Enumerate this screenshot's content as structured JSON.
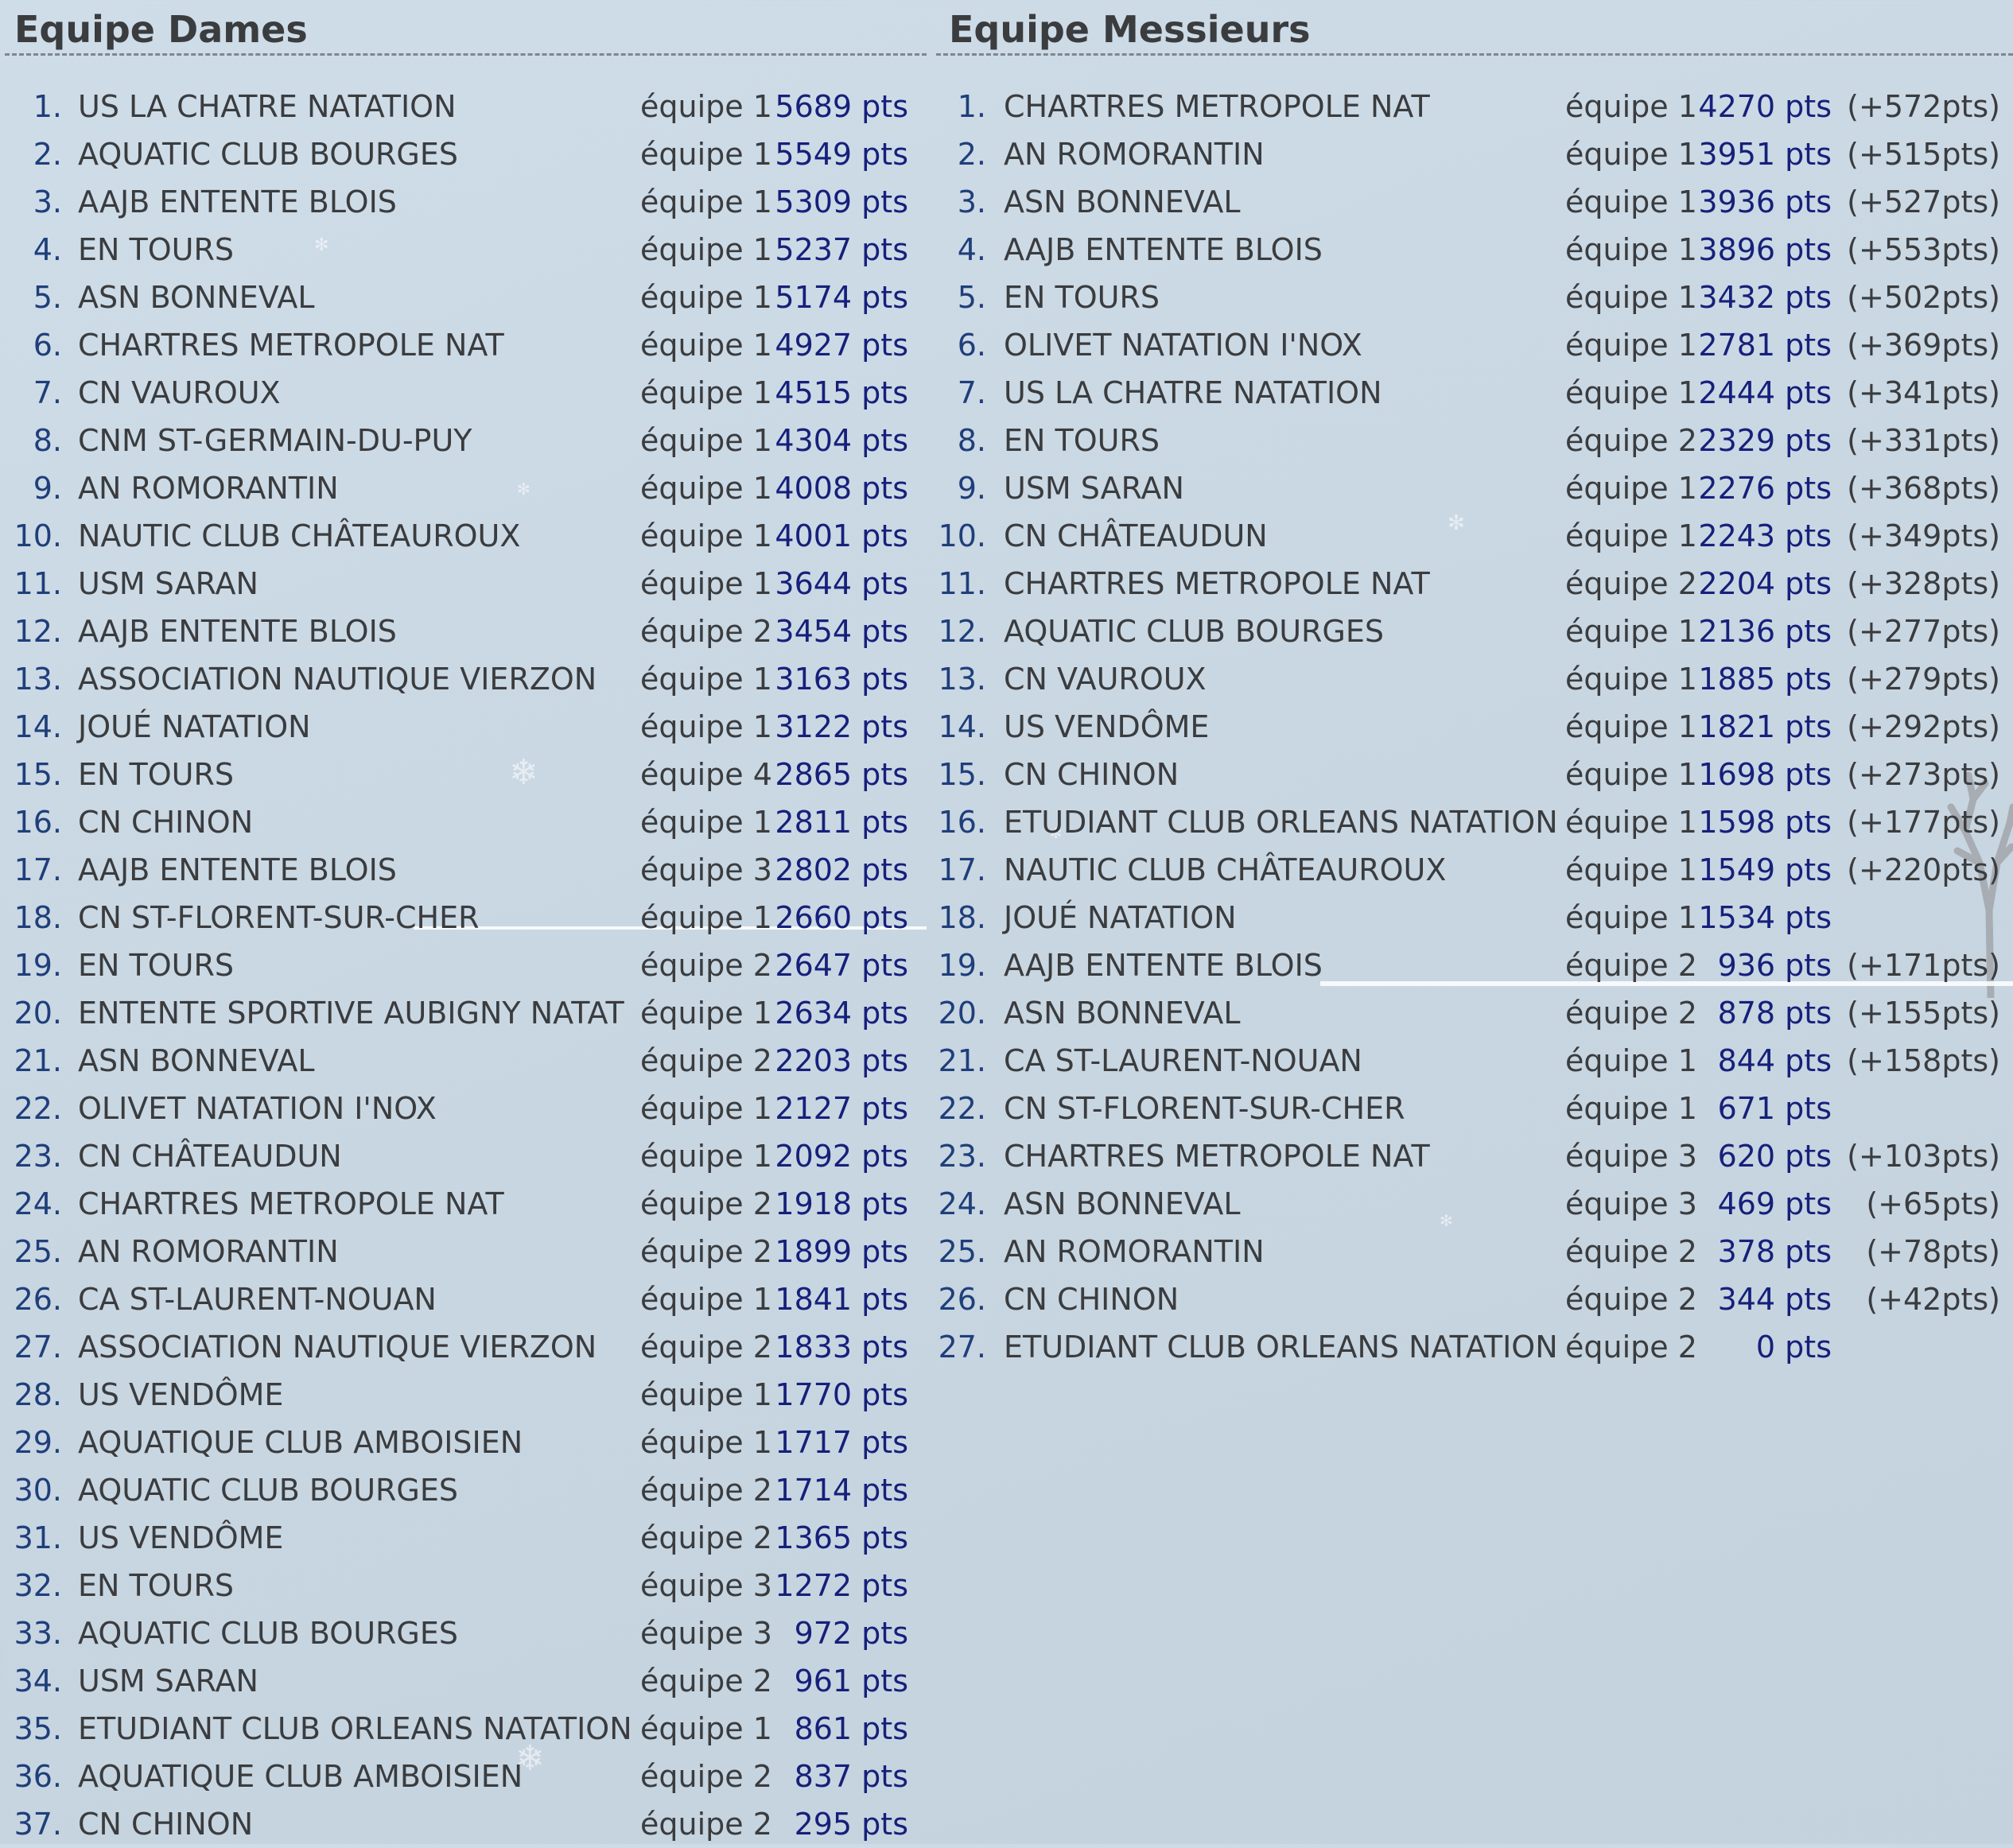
{
  "dames": {
    "title": "Equipe Dames",
    "rows": [
      {
        "rank": "1.",
        "club": "US LA CHATRE NATATION",
        "team": "équipe 1",
        "pts": "5689 pts"
      },
      {
        "rank": "2.",
        "club": "AQUATIC CLUB BOURGES",
        "team": "équipe 1",
        "pts": "5549 pts"
      },
      {
        "rank": "3.",
        "club": "AAJB ENTENTE BLOIS",
        "team": "équipe 1",
        "pts": "5309 pts"
      },
      {
        "rank": "4.",
        "club": "EN TOURS",
        "team": "équipe 1",
        "pts": "5237 pts"
      },
      {
        "rank": "5.",
        "club": "ASN BONNEVAL",
        "team": "équipe 1",
        "pts": "5174 pts"
      },
      {
        "rank": "6.",
        "club": "CHARTRES METROPOLE NAT",
        "team": "équipe 1",
        "pts": "4927 pts"
      },
      {
        "rank": "7.",
        "club": "CN VAUROUX",
        "team": "équipe 1",
        "pts": "4515 pts"
      },
      {
        "rank": "8.",
        "club": "CNM ST-GERMAIN-DU-PUY",
        "team": "équipe 1",
        "pts": "4304 pts"
      },
      {
        "rank": "9.",
        "club": "AN ROMORANTIN",
        "team": "équipe 1",
        "pts": "4008 pts"
      },
      {
        "rank": "10.",
        "club": "NAUTIC CLUB CHÂTEAUROUX",
        "team": "équipe 1",
        "pts": "4001 pts"
      },
      {
        "rank": "11.",
        "club": "USM SARAN",
        "team": "équipe 1",
        "pts": "3644 pts"
      },
      {
        "rank": "12.",
        "club": "AAJB ENTENTE BLOIS",
        "team": "équipe 2",
        "pts": "3454 pts"
      },
      {
        "rank": "13.",
        "club": "ASSOCIATION NAUTIQUE VIERZON",
        "team": "équipe 1",
        "pts": "3163 pts"
      },
      {
        "rank": "14.",
        "club": "JOUÉ NATATION",
        "team": "équipe 1",
        "pts": "3122 pts"
      },
      {
        "rank": "15.",
        "club": "EN TOURS",
        "team": "équipe 4",
        "pts": "2865 pts"
      },
      {
        "rank": "16.",
        "club": "CN CHINON",
        "team": "équipe 1",
        "pts": "2811 pts"
      },
      {
        "rank": "17.",
        "club": "AAJB ENTENTE BLOIS",
        "team": "équipe 3",
        "pts": "2802 pts"
      },
      {
        "rank": "18.",
        "club": "CN ST-FLORENT-SUR-CHER",
        "team": "équipe 1",
        "pts": "2660 pts"
      },
      {
        "rank": "19.",
        "club": "EN TOURS",
        "team": "équipe 2",
        "pts": "2647 pts"
      },
      {
        "rank": "20.",
        "club": "ENTENTE SPORTIVE AUBIGNY NATAT",
        "team": "équipe 1",
        "pts": "2634 pts"
      },
      {
        "rank": "21.",
        "club": "ASN BONNEVAL",
        "team": "équipe 2",
        "pts": "2203 pts"
      },
      {
        "rank": "22.",
        "club": "OLIVET NATATION I'NOX",
        "team": "équipe 1",
        "pts": "2127 pts"
      },
      {
        "rank": "23.",
        "club": "CN CHÂTEAUDUN",
        "team": "équipe 1",
        "pts": "2092 pts"
      },
      {
        "rank": "24.",
        "club": "CHARTRES METROPOLE NAT",
        "team": "équipe 2",
        "pts": "1918 pts"
      },
      {
        "rank": "25.",
        "club": "AN ROMORANTIN",
        "team": "équipe 2",
        "pts": "1899 pts"
      },
      {
        "rank": "26.",
        "club": "CA ST-LAURENT-NOUAN",
        "team": "équipe 1",
        "pts": "1841 pts"
      },
      {
        "rank": "27.",
        "club": "ASSOCIATION NAUTIQUE VIERZON",
        "team": "équipe 2",
        "pts": "1833 pts"
      },
      {
        "rank": "28.",
        "club": "US VENDÔME",
        "team": "équipe 1",
        "pts": "1770 pts"
      },
      {
        "rank": "29.",
        "club": "AQUATIQUE CLUB AMBOISIEN",
        "team": "équipe 1",
        "pts": "1717 pts"
      },
      {
        "rank": "30.",
        "club": "AQUATIC CLUB BOURGES",
        "team": "équipe 2",
        "pts": "1714 pts"
      },
      {
        "rank": "31.",
        "club": "US VENDÔME",
        "team": "équipe 2",
        "pts": "1365 pts"
      },
      {
        "rank": "32.",
        "club": "EN TOURS",
        "team": "équipe 3",
        "pts": "1272 pts"
      },
      {
        "rank": "33.",
        "club": "AQUATIC CLUB BOURGES",
        "team": "équipe 3",
        "pts": "972 pts"
      },
      {
        "rank": "34.",
        "club": "USM SARAN",
        "team": "équipe 2",
        "pts": "961 pts"
      },
      {
        "rank": "35.",
        "club": "ETUDIANT CLUB ORLEANS NATATION",
        "team": "équipe 1",
        "pts": "861 pts"
      },
      {
        "rank": "36.",
        "club": "AQUATIQUE CLUB AMBOISIEN",
        "team": "équipe 2",
        "pts": "837 pts"
      },
      {
        "rank": "37.",
        "club": "CN CHINON",
        "team": "équipe 2",
        "pts": "295 pts"
      }
    ]
  },
  "messieurs": {
    "title": "Equipe Messieurs",
    "rows": [
      {
        "rank": "1.",
        "club": "CHARTRES METROPOLE NAT",
        "team": "équipe 1",
        "pts": "4270 pts",
        "delta": "(+572pts)"
      },
      {
        "rank": "2.",
        "club": "AN ROMORANTIN",
        "team": "équipe 1",
        "pts": "3951 pts",
        "delta": "(+515pts)"
      },
      {
        "rank": "3.",
        "club": "ASN BONNEVAL",
        "team": "équipe 1",
        "pts": "3936 pts",
        "delta": "(+527pts)"
      },
      {
        "rank": "4.",
        "club": "AAJB ENTENTE BLOIS",
        "team": "équipe 1",
        "pts": "3896 pts",
        "delta": "(+553pts)"
      },
      {
        "rank": "5.",
        "club": "EN TOURS",
        "team": "équipe 1",
        "pts": "3432 pts",
        "delta": "(+502pts)"
      },
      {
        "rank": "6.",
        "club": "OLIVET NATATION I'NOX",
        "team": "équipe 1",
        "pts": "2781 pts",
        "delta": "(+369pts)"
      },
      {
        "rank": "7.",
        "club": "US LA CHATRE NATATION",
        "team": "équipe 1",
        "pts": "2444 pts",
        "delta": "(+341pts)"
      },
      {
        "rank": "8.",
        "club": "EN TOURS",
        "team": "équipe 2",
        "pts": "2329 pts",
        "delta": "(+331pts)"
      },
      {
        "rank": "9.",
        "club": "USM SARAN",
        "team": "équipe 1",
        "pts": "2276 pts",
        "delta": "(+368pts)"
      },
      {
        "rank": "10.",
        "club": "CN CHÂTEAUDUN",
        "team": "équipe 1",
        "pts": "2243 pts",
        "delta": "(+349pts)"
      },
      {
        "rank": "11.",
        "club": "CHARTRES METROPOLE NAT",
        "team": "équipe 2",
        "pts": "2204 pts",
        "delta": "(+328pts)"
      },
      {
        "rank": "12.",
        "club": "AQUATIC CLUB BOURGES",
        "team": "équipe 1",
        "pts": "2136 pts",
        "delta": "(+277pts)"
      },
      {
        "rank": "13.",
        "club": "CN VAUROUX",
        "team": "équipe 1",
        "pts": "1885 pts",
        "delta": "(+279pts)"
      },
      {
        "rank": "14.",
        "club": "US VENDÔME",
        "team": "équipe 1",
        "pts": "1821 pts",
        "delta": "(+292pts)"
      },
      {
        "rank": "15.",
        "club": "CN CHINON",
        "team": "équipe 1",
        "pts": "1698 pts",
        "delta": "(+273pts)"
      },
      {
        "rank": "16.",
        "club": "ETUDIANT CLUB ORLEANS NATATION",
        "team": "équipe 1",
        "pts": "1598 pts",
        "delta": "(+177pts)"
      },
      {
        "rank": "17.",
        "club": "NAUTIC CLUB CHÂTEAUROUX",
        "team": "équipe 1",
        "pts": "1549 pts",
        "delta": "(+220pts)"
      },
      {
        "rank": "18.",
        "club": "JOUÉ NATATION",
        "team": "équipe 1",
        "pts": "1534 pts",
        "delta": ""
      },
      {
        "rank": "19.",
        "club": "AAJB ENTENTE BLOIS",
        "team": "équipe 2",
        "pts": "936 pts",
        "delta": "(+171pts)"
      },
      {
        "rank": "20.",
        "club": "ASN BONNEVAL",
        "team": "équipe 2",
        "pts": "878 pts",
        "delta": "(+155pts)"
      },
      {
        "rank": "21.",
        "club": "CA ST-LAURENT-NOUAN",
        "team": "équipe 1",
        "pts": "844 pts",
        "delta": "(+158pts)"
      },
      {
        "rank": "22.",
        "club": "CN ST-FLORENT-SUR-CHER",
        "team": "équipe 1",
        "pts": "671 pts",
        "delta": ""
      },
      {
        "rank": "23.",
        "club": "CHARTRES METROPOLE NAT",
        "team": "équipe 3",
        "pts": "620 pts",
        "delta": "(+103pts)"
      },
      {
        "rank": "24.",
        "club": "ASN BONNEVAL",
        "team": "équipe 3",
        "pts": "469 pts",
        "delta": "(+65pts)"
      },
      {
        "rank": "25.",
        "club": "AN ROMORANTIN",
        "team": "équipe 2",
        "pts": "378 pts",
        "delta": "(+78pts)"
      },
      {
        "rank": "26.",
        "club": "CN CHINON",
        "team": "équipe 2",
        "pts": "344 pts",
        "delta": "(+42pts)"
      },
      {
        "rank": "27.",
        "club": "ETUDIANT CLUB ORLEANS NATATION",
        "team": "équipe 2",
        "pts": "0 pts",
        "delta": ""
      }
    ]
  },
  "decor": {
    "snowflake_icon": "snowflake-icon",
    "tree_icon": "bare-tree-icon"
  }
}
